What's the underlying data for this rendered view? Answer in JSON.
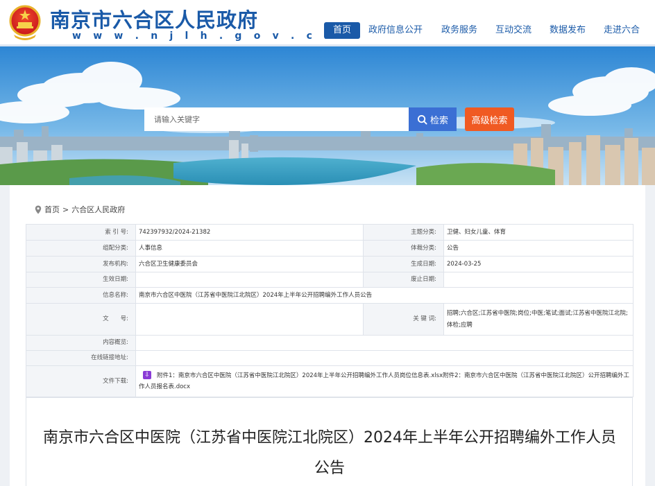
{
  "header": {
    "site_title": "南京市六合区人民政府",
    "site_url": "w w w . n j l h . g o v . c n"
  },
  "nav": {
    "items": [
      "首页",
      "政府信息公开",
      "政务服务",
      "互动交流",
      "数据发布",
      "走进六合"
    ],
    "active_index": 0
  },
  "search": {
    "placeholder": "请输入关键字",
    "button_label": "检索",
    "advanced_label": "高级检索"
  },
  "breadcrumb": {
    "home": "首页",
    "separator": ">",
    "current": "六合区人民政府"
  },
  "meta": {
    "index_label": "索 引 号:",
    "index_value": "742397932/2024-21382",
    "topic_label": "主题分类:",
    "topic_value": "卫健、妇女儿童、体育",
    "org_cat_label": "组配分类:",
    "org_cat_value": "人事信息",
    "genre_label": "体裁分类:",
    "genre_value": "公告",
    "publisher_label": "发布机构:",
    "publisher_value": "六合区卫生健康委员会",
    "created_label": "生成日期:",
    "created_value": "2024-03-25",
    "effective_label": "生效日期:",
    "effective_value": "",
    "expire_label": "废止日期:",
    "expire_value": "",
    "name_label": "信息名称:",
    "name_value": "南京市六合区中医院（江苏省中医院江北院区）2024年上半年公开招聘编外工作人员公告",
    "docno_label": "文　　号:",
    "docno_value": "",
    "keywords_label": "关 键 词:",
    "keywords_value": "招聘;六合区;江苏省中医院;岗位;中医;笔试;面试;江苏省中医院江北院;体检;应聘",
    "summary_label": "内容概览:",
    "summary_value": "",
    "link_label": "在线链接地址:",
    "link_value": "",
    "download_label": "文件下载:",
    "download_value": "附件1：南京市六合区中医院（江苏省中医院江北院区）2024年上半年公开招聘编外工作人员岗位信息表.xlsx附件2：南京市六合区中医院（江苏省中医院江北院区）公开招聘编外工作人员报名表.docx"
  },
  "article": {
    "title": "南京市六合区中医院（江苏省中医院江北院区）2024年上半年公开招聘编外工作人员公告"
  },
  "colors": {
    "brand_blue": "#1a5aa8",
    "search_blue": "#3b6fd4",
    "advanced_orange": "#f05a22"
  }
}
